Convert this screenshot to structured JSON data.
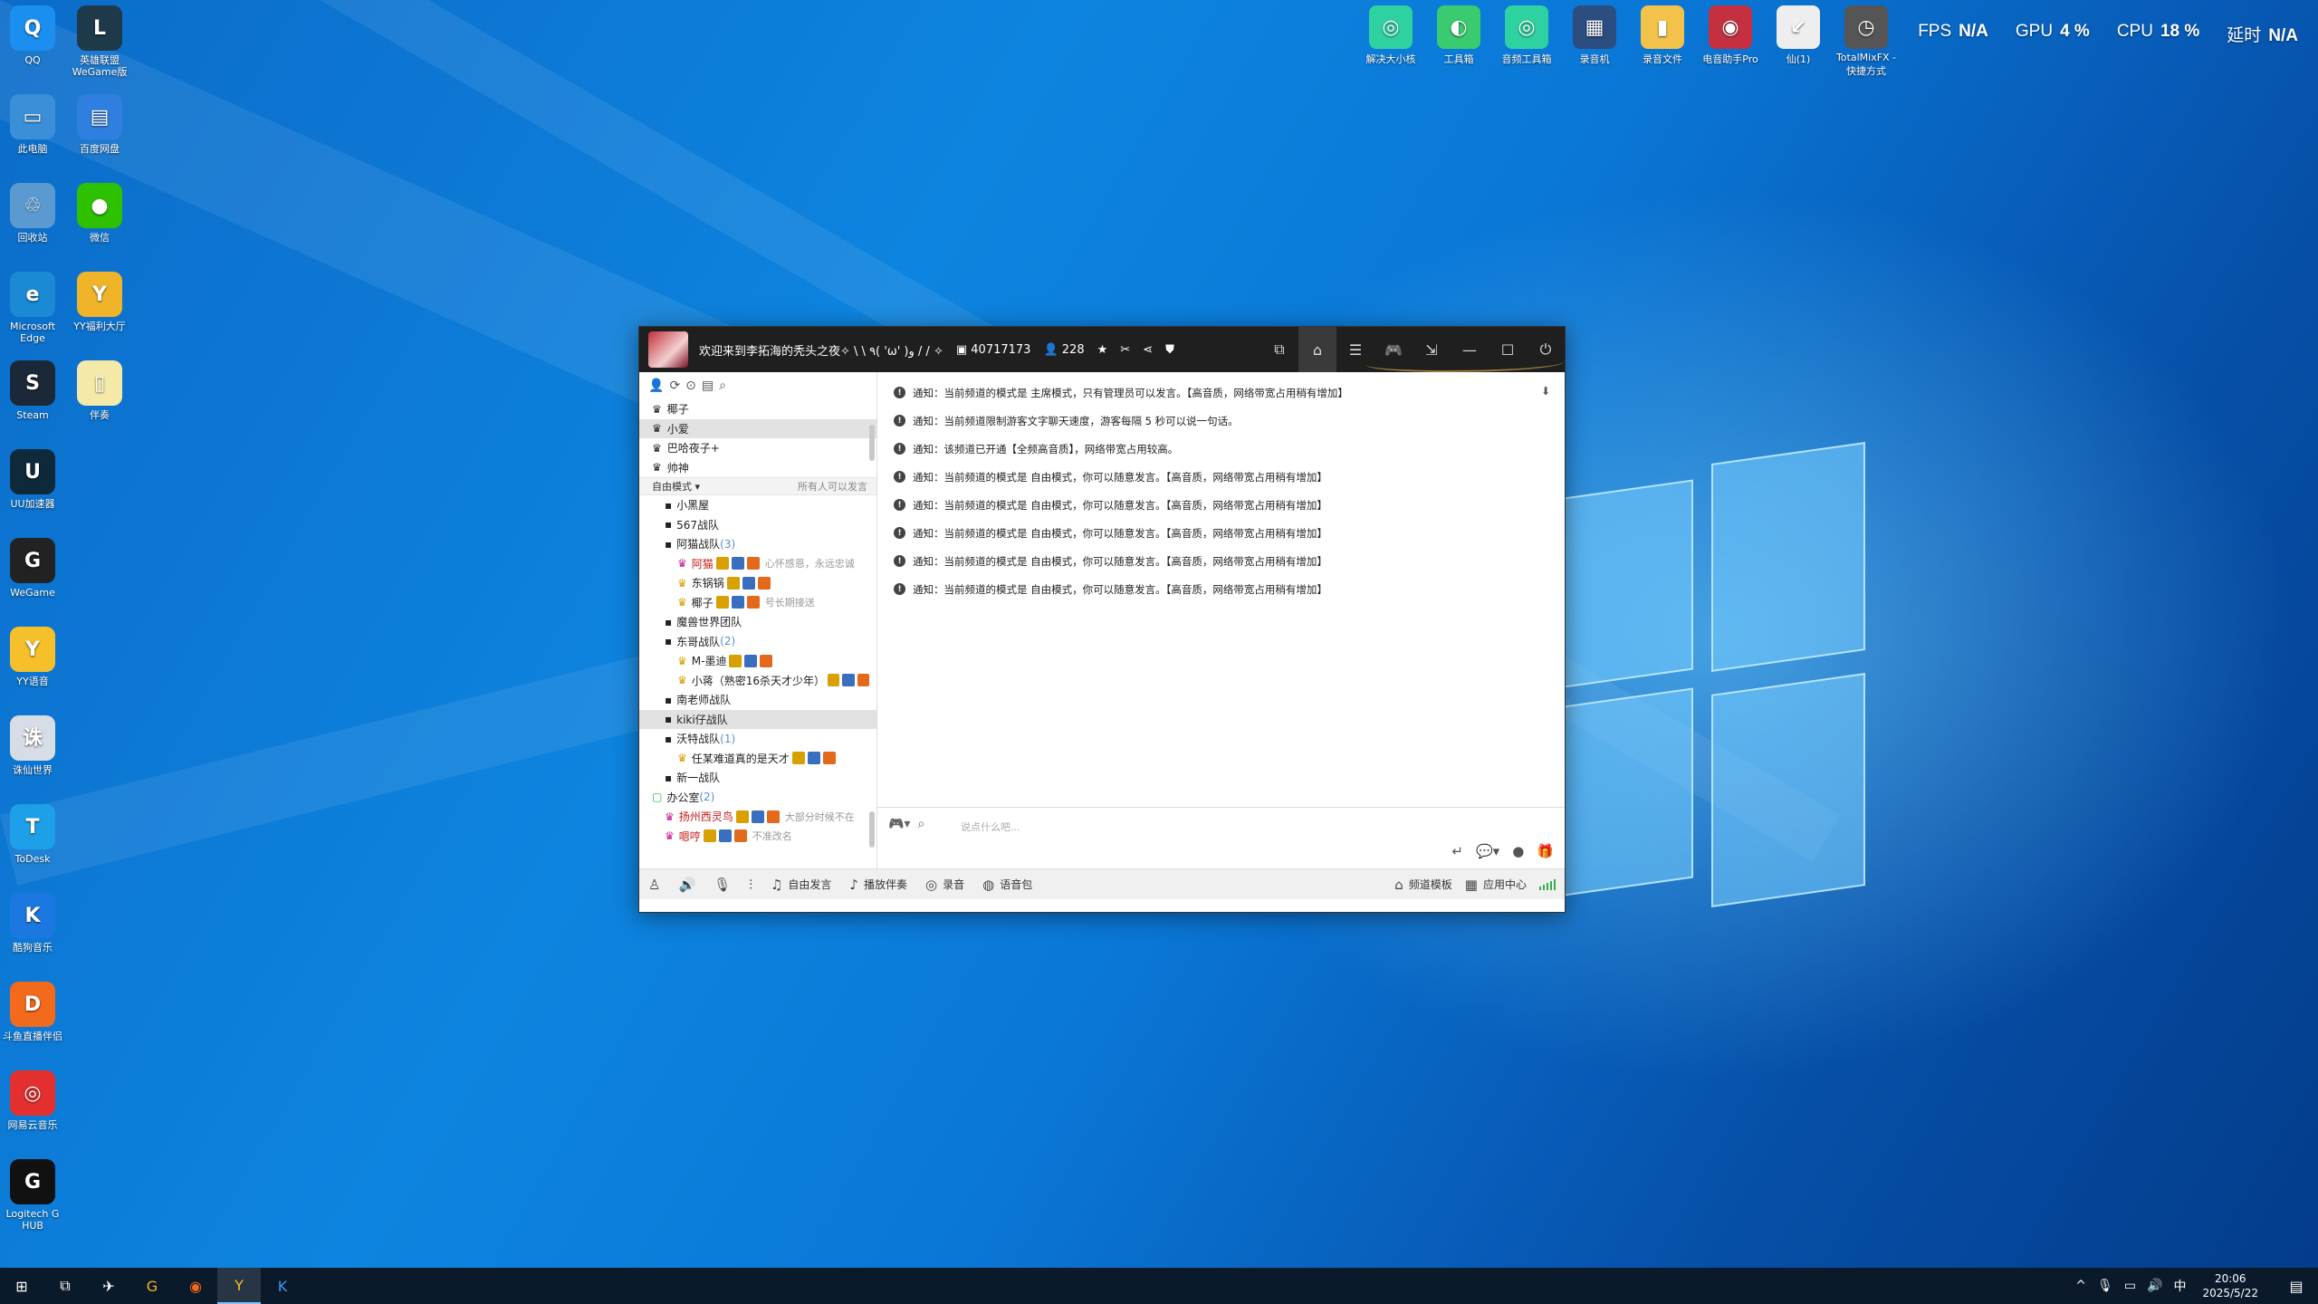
{
  "desktop_icons": [
    {
      "label": "QQ",
      "color": "#1b8ff0",
      "glyph": "Q"
    },
    {
      "label": "英雄联盟 WeGame版",
      "color": "#1e3a4a",
      "glyph": "L"
    },
    {
      "label": "此电脑",
      "color": "#3a8fd8",
      "glyph": "▭"
    },
    {
      "label": "百度网盘",
      "color": "#2f7fe0",
      "glyph": "▤"
    },
    {
      "label": "回收站",
      "color": "#5a9ad0",
      "glyph": "♲"
    },
    {
      "label": "微信",
      "color": "#2dc100",
      "glyph": "●"
    },
    {
      "label": "Microsoft Edge",
      "color": "#1a8ad4",
      "glyph": "e"
    },
    {
      "label": "YY福利大厅",
      "color": "#f0b429",
      "glyph": "Y"
    },
    {
      "label": "Steam",
      "color": "#1b2838",
      "glyph": "S"
    },
    {
      "label": "伴奏",
      "color": "#f5e9a8",
      "glyph": "▯"
    },
    {
      "label": "UU加速器",
      "color": "#0e2a3a",
      "glyph": "U"
    },
    {
      "label": "WeGame",
      "color": "#222",
      "glyph": "G"
    },
    {
      "label": "YY语音",
      "color": "#f5c02a",
      "glyph": "Y"
    },
    {
      "label": "诛仙世界",
      "color": "#d7dde6",
      "glyph": "诛"
    },
    {
      "label": "ToDesk",
      "color": "#1ea0e8",
      "glyph": "T"
    },
    {
      "label": "酷狗音乐",
      "color": "#1b78e0",
      "glyph": "K"
    },
    {
      "label": "斗鱼直播伴侣",
      "color": "#f46a1c",
      "glyph": "D"
    },
    {
      "label": "网易云音乐",
      "color": "#e42f2f",
      "glyph": "◎"
    },
    {
      "label": "Logitech G HUB",
      "color": "#111",
      "glyph": "G"
    }
  ],
  "top_apps": [
    {
      "label": "解决大小核",
      "color": "#2ed2a0",
      "glyph": "◎"
    },
    {
      "label": "工具箱",
      "color": "#3acb70",
      "glyph": "◐"
    },
    {
      "label": "音频工具箱",
      "color": "#2ed2a0",
      "glyph": "◎"
    },
    {
      "label": "录音机",
      "color": "#2b4d80",
      "glyph": "▦"
    },
    {
      "label": "录音文件",
      "color": "#f2c24a",
      "glyph": "▮"
    },
    {
      "label": "电音助手Pro",
      "color": "#c43040",
      "glyph": "◉"
    },
    {
      "label": "仙(1)",
      "color": "#eeeeee",
      "glyph": "↙"
    },
    {
      "label": "TotalMixFX - 快捷方式",
      "color": "#555",
      "glyph": "◷"
    }
  ],
  "stats": [
    {
      "label": "FPS",
      "value": "N/A"
    },
    {
      "label": "GPU",
      "value": "4 %"
    },
    {
      "label": "CPU",
      "value": "18 %"
    },
    {
      "label": "延时",
      "value": "N/A"
    }
  ],
  "window": {
    "title": "欢迎来到李拓海的秃头之夜✧ \\ \\ ٩( 'ω' )و / / ✧",
    "room_id": "40717173",
    "online_count": "228",
    "mode_label": "自由模式",
    "mode_right": "所有人可以发言",
    "input_placeholder": "说点什么吧...",
    "bottom_items": [
      {
        "icon": "♫",
        "label": "自由发言"
      },
      {
        "icon": "♪",
        "label": "播放伴奏"
      },
      {
        "icon": "◎",
        "label": "录音"
      },
      {
        "icon": "◍",
        "label": "语音包"
      }
    ],
    "bottom_right": [
      {
        "icon": "⌂",
        "label": "频道模板"
      },
      {
        "icon": "▦",
        "label": "应用中心"
      }
    ]
  },
  "tree_top": [
    {
      "label": "椰子",
      "selected": false
    },
    {
      "label": "小爱",
      "selected": true
    },
    {
      "label": "巴哈夜子+",
      "selected": false
    },
    {
      "label": "帅神",
      "selected": false
    }
  ],
  "tree": [
    {
      "indent": 1,
      "label": "小黑屋",
      "count": "",
      "sub": ""
    },
    {
      "indent": 1,
      "label": "567战队",
      "count": "",
      "sub": ""
    },
    {
      "indent": 1,
      "label": "阿猫战队",
      "count": "(3)",
      "sub": ""
    },
    {
      "indent": 2,
      "label": "阿猫",
      "count": "",
      "sub": "心怀感恩，永远忠诚",
      "red": true
    },
    {
      "indent": 2,
      "label": "东锅锅",
      "count": "",
      "sub": ""
    },
    {
      "indent": 2,
      "label": "椰子",
      "count": "",
      "sub": "号长期接送"
    },
    {
      "indent": 1,
      "label": "魔兽世界团队",
      "count": "",
      "sub": ""
    },
    {
      "indent": 1,
      "label": "东哥战队",
      "count": "(2)",
      "sub": ""
    },
    {
      "indent": 2,
      "label": "M-墨迪",
      "count": "",
      "sub": ""
    },
    {
      "indent": 2,
      "label": "小蒋（熟密16杀天才少年）",
      "count": "",
      "sub": ""
    },
    {
      "indent": 1,
      "label": "南老师战队",
      "count": "",
      "sub": ""
    },
    {
      "indent": 1,
      "label": "kiki仔战队",
      "count": "",
      "sub": "",
      "selected": true
    },
    {
      "indent": 1,
      "label": "沃特战队",
      "count": "(1)",
      "sub": ""
    },
    {
      "indent": 2,
      "label": "任某难道真的是天才",
      "count": "",
      "sub": ""
    },
    {
      "indent": 1,
      "label": "新一战队",
      "count": "",
      "sub": ""
    },
    {
      "indent": 0,
      "label": "办公室",
      "count": "(2)",
      "sub": "",
      "green": true
    },
    {
      "indent": 1,
      "label": "扬州西灵鸟",
      "count": "",
      "sub": "大部分时候不在",
      "red": true
    },
    {
      "indent": 1,
      "label": "嗯哼",
      "count": "",
      "sub": "不准改名",
      "red": true
    }
  ],
  "messages": [
    "通知：当前频道的模式是 主席模式，只有管理员可以发言。【高音质，网络带宽占用稍有增加】",
    "通知：当前频道限制游客文字聊天速度，游客每隔 5 秒可以说一句话。",
    "通知：该频道已开通【全频高音质】，网络带宽占用较高。",
    "通知：当前频道的模式是 自由模式，你可以随意发言。【高音质，网络带宽占用稍有增加】",
    "通知：当前频道的模式是 自由模式，你可以随意发言。【高音质，网络带宽占用稍有增加】",
    "通知：当前频道的模式是 自由模式，你可以随意发言。【高音质，网络带宽占用稍有增加】",
    "通知：当前频道的模式是 自由模式，你可以随意发言。【高音质，网络带宽占用稍有增加】",
    "通知：当前频道的模式是 自由模式，你可以随意发言。【高音质，网络带宽占用稍有增加】"
  ],
  "taskbar": {
    "tray_icons": [
      "^",
      "🎙",
      "▭",
      "🔊",
      "中"
    ],
    "time": "20:06",
    "date": "2025/5/22"
  }
}
